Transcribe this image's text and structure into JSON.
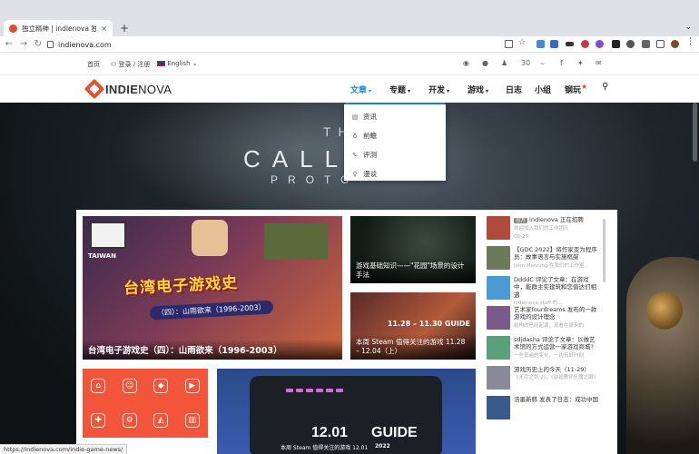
{
  "browser": {
    "tab_title": "独立精神 | indienova 独立游戏",
    "tab_close": "×",
    "new_tab": "+",
    "tabs_menu": "⌄",
    "url": "indienova.com",
    "back": "←",
    "forward": "→",
    "reload": "↻"
  },
  "sitetop": {
    "home": "首页",
    "login": "登录 / 注册",
    "language": "English",
    "social_count": "30"
  },
  "nav": {
    "logo_indie": "INDIE",
    "logo_nova": "NOVA",
    "items": [
      "文章",
      "专题",
      "开发",
      "游戏",
      "日志",
      "小组",
      "钢玩"
    ],
    "caret": "▾",
    "hot": "★",
    "search_glyph": "⚲"
  },
  "hero": {
    "top": "TH",
    "title": "CALL",
    "subtitle": "PROTO"
  },
  "dropdown": {
    "items": [
      "资讯",
      "前瞻",
      "评测",
      "漫谈"
    ]
  },
  "cards": {
    "big_banner": "台湾电子游戏史",
    "big_subbanner": "（四）：山雨欲来（1996-2003）",
    "big_caption": "台湾电子游戏史（四）：山雨欲来（1996-2003）",
    "big_taiwan": "TAIWAN",
    "sm1_caption": "游戏基础知识——\"花园\"场景的设计手法",
    "sm2_caption": "本周 Steam 值得关注的游戏 11.28 – 12.04（上）",
    "sm2_overlay": "11.28 – 11.30 GUIDE",
    "guide_date": "12.01",
    "guide_word": "GUIDE",
    "guide_sub": "本周 Steam 值得关注的游戏 12.01",
    "guide_year": "2022"
  },
  "feed": [
    {
      "tag": "官方",
      "text": "indienova 正在招聘",
      "sub": "欢迎加入我们的工作团队",
      "meta": "09-25",
      "color": "#b04a3a"
    },
    {
      "tag": "",
      "text": "【GDC 2022】将作家变为程序员：故事语言与实施框架",
      "sub": "John Manning 在我们的工作室...",
      "meta": "",
      "color": "#6a7a5a"
    },
    {
      "tag": "",
      "text": "DdddC 评论了文章：在游戏中，能群主实建筑和您值达们相遇",
      "sub": "indienova-staff 的...",
      "meta": "",
      "color": "#4a9ad4"
    },
    {
      "tag": "",
      "text": "艺术家fourdreams 发布的一款游戏的设计理念",
      "sub": "结构的已经起源，观看在原来的",
      "meta": "",
      "color": "#7a5a8a"
    },
    {
      "tag": "",
      "text": "sdjdasha 评论了文章：以做艺术馆的方式运营一家游戏商城?",
      "sub": "一些普遍的变化，一边有好时刻",
      "meta": "",
      "color": "#5aa07a"
    },
    {
      "tag": "",
      "text": "游戏历史上的今天（11-29）",
      "sub": "《无尽之剑 2》，《原始教师乐魔之眼》",
      "meta": "",
      "color": "#8a8a9a"
    },
    {
      "tag": "",
      "text": "浩墨新韩 发表了日志：成功中国",
      "sub": "",
      "meta": "",
      "color": "#3a5a8a"
    }
  ],
  "status_url": "https://indienova.com/indie-game-news/",
  "colors": {
    "brand": "#e8502e",
    "accent": "#1a8ad4",
    "orange_card": "#f2553a"
  }
}
